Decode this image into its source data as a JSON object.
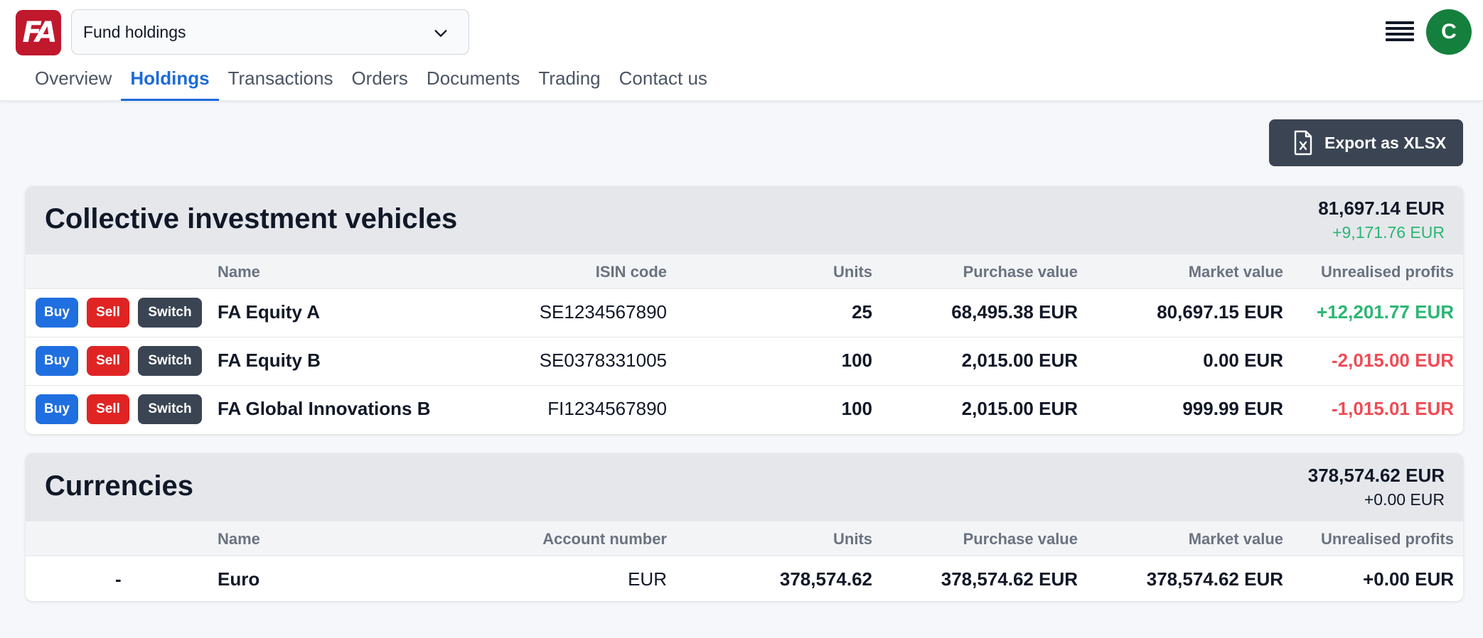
{
  "header": {
    "logo_text": "FA",
    "selector_value": "Fund holdings",
    "avatar_initial": "C",
    "brand_color": "#c0182d",
    "avatar_color": "#15803d"
  },
  "tabs": [
    {
      "label": "Overview",
      "active": false
    },
    {
      "label": "Holdings",
      "active": true
    },
    {
      "label": "Transactions",
      "active": false
    },
    {
      "label": "Orders",
      "active": false
    },
    {
      "label": "Documents",
      "active": false
    },
    {
      "label": "Trading",
      "active": false
    },
    {
      "label": "Contact us",
      "active": false
    }
  ],
  "export": {
    "label": "Export as XLSX",
    "icon": "file-excel-icon"
  },
  "civ": {
    "title": "Collective investment vehicles",
    "total": "81,697.14 EUR",
    "change": "+9,171.76 EUR",
    "columns": {
      "name": "Name",
      "code": "ISIN code",
      "units": "Units",
      "purchase": "Purchase value",
      "market": "Market value",
      "unrealised": "Unrealised profits"
    },
    "buttons": {
      "buy": "Buy",
      "sell": "Sell",
      "switch": "Switch"
    },
    "rows": [
      {
        "name": "FA Equity A",
        "code": "SE1234567890",
        "units": "25",
        "purchase": "68,495.38 EUR",
        "market": "80,697.15 EUR",
        "unrealised": "+12,201.77 EUR"
      },
      {
        "name": "FA Equity B",
        "code": "SE0378331005",
        "units": "100",
        "purchase": "2,015.00 EUR",
        "market": "0.00 EUR",
        "unrealised": "-2,015.00 EUR"
      },
      {
        "name": "FA Global Innovations B",
        "code": "FI1234567890",
        "units": "100",
        "purchase": "2,015.00 EUR",
        "market": "999.99 EUR",
        "unrealised": "-1,015.01 EUR"
      }
    ]
  },
  "currencies": {
    "title": "Currencies",
    "total": "378,574.62 EUR",
    "change": "+0.00 EUR",
    "columns": {
      "name": "Name",
      "code": "Account number",
      "units": "Units",
      "purchase": "Purchase value",
      "market": "Market value",
      "unrealised": "Unrealised profits"
    },
    "rows": [
      {
        "action": "-",
        "name": "Euro",
        "code": "EUR",
        "units": "378,574.62",
        "purchase": "378,574.62 EUR",
        "market": "378,574.62 EUR",
        "unrealised": "+0.00 EUR"
      }
    ]
  },
  "colors": {
    "accent": "#1d6bd9",
    "positive": "#2bb673",
    "negative": "#ef4b55",
    "dark_button": "#3a4453",
    "buy": "#1f6fe0",
    "sell": "#e02424"
  }
}
